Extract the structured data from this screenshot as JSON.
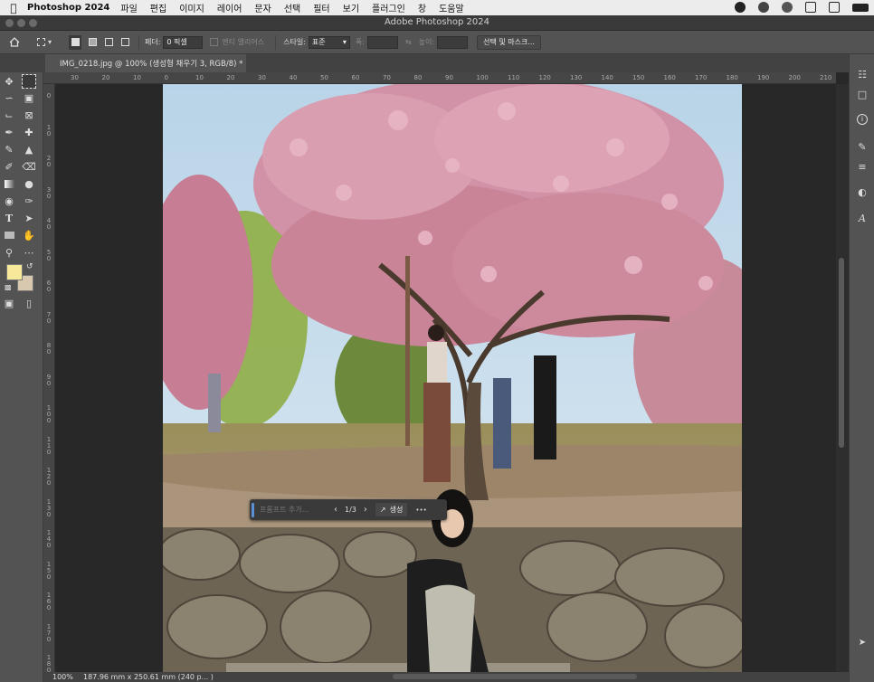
{
  "menubar": {
    "app_name": "Photoshop 2024",
    "items": [
      "파일",
      "편집",
      "이미지",
      "레이어",
      "문자",
      "선택",
      "필터",
      "보기",
      "플러그인",
      "창",
      "도움말"
    ]
  },
  "window": {
    "title": "Adobe Photoshop 2024"
  },
  "options": {
    "feather_label": "페더:",
    "feather_value": "0 픽셀",
    "antialias_label": "앤티 앨리어스",
    "style_label": "스타일:",
    "style_value": "표준",
    "width_label": "폭:",
    "height_label": "높이:",
    "select_mask_button": "선택 및 마스크..."
  },
  "document": {
    "tab_title": "IMG_0218.jpg @ 100% (생성형 채우기 3, RGB/8) *"
  },
  "ruler": {
    "h_ticks": [
      "30",
      "20",
      "10",
      "0",
      "10",
      "20",
      "30",
      "40",
      "50",
      "60",
      "70",
      "80",
      "90",
      "100",
      "110",
      "120",
      "130",
      "140",
      "150",
      "160",
      "170",
      "180",
      "190",
      "200",
      "210"
    ],
    "v_ticks": [
      "0",
      "1 0",
      "2 0",
      "3 0",
      "4 0",
      "5 0",
      "6 0",
      "7 0",
      "8 0",
      "9 0",
      "1 0 0",
      "1 1 0",
      "1 2 0",
      "1 3 0",
      "1 4 0",
      "1 5 0",
      "1 6 0",
      "1 7 0",
      "1 8 0"
    ]
  },
  "contextual_bar": {
    "prompt_placeholder": "프롬프트 추가...",
    "variation_counter": "1/3",
    "generate_label": "생성",
    "more_label": "•••"
  },
  "status": {
    "zoom": "100%",
    "doc_size": "187.96 mm x 250.61 mm (240 p... )"
  },
  "colors": {
    "foreground": "#f7e99a",
    "background": "#d8c8b0",
    "accent": "#5b8fd6"
  },
  "icons": {
    "tools": [
      "move-icon",
      "marquee-icon",
      "lasso-icon",
      "object-select-icon",
      "crop-icon",
      "frame-icon",
      "eyedropper-icon",
      "healing-icon",
      "brush-icon",
      "stamp-icon",
      "history-brush-icon",
      "eraser-icon",
      "gradient-icon",
      "blur-icon",
      "dodge-icon",
      "pen-icon",
      "type-icon",
      "path-select-icon",
      "rectangle-icon",
      "hand-icon",
      "zoom-icon",
      "more-tools-icon"
    ],
    "right_panel": [
      "layers-icon",
      "comments-icon",
      "info-icon",
      "brush-settings-icon",
      "adjustments-icon",
      "shape-icon",
      "glyphs-icon"
    ]
  }
}
